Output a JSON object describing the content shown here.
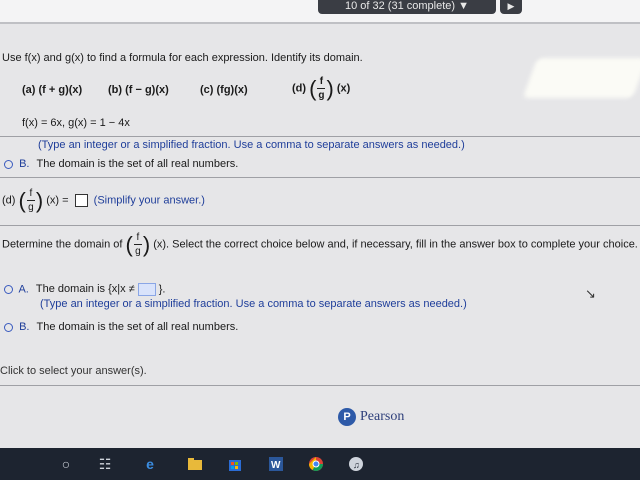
{
  "header": {
    "progress_text": "10 of 32 (31 complete)",
    "next_arrow": "▶",
    "dropdown_arrow": "▼"
  },
  "instructions": "Use f(x) and g(x) to find a formula for each expression. Identify its domain.",
  "parts": {
    "a": "(a) (f + g)(x)",
    "b": "(b) (f − g)(x)",
    "c": "(c) (fg)(x)",
    "d_label": "(d)",
    "d_suffix": "(x)"
  },
  "functions": "f(x) = 6x, g(x) = 1 − 4x",
  "prev_hint": "(Type an integer or a simplified fraction. Use a comma to separate answers as needed.)",
  "prev_choice_b": {
    "letter": "B.",
    "text": "The domain is the set of all real numbers."
  },
  "current": {
    "label": "(d)",
    "suffix": "(x) =",
    "hint": "(Simplify your answer.)"
  },
  "domain_prompt": {
    "prefix": "Determine the domain of",
    "suffix": "(x). Select the correct choice below and, if necessary, fill in the answer box to complete your choice."
  },
  "choices": [
    {
      "letter": "A.",
      "text": "The domain is {x|x ≠",
      "close": "}.",
      "hint": "(Type an integer or a simplified fraction. Use a comma to separate answers as needed.)"
    },
    {
      "letter": "B.",
      "text": "The domain is the set of all real numbers."
    }
  ],
  "footer_hint": "Click to select your answer(s).",
  "brand": "Pearson",
  "fraction": {
    "num": "f",
    "den": "g"
  },
  "taskbar_icons": [
    "cortana-circle",
    "task-view",
    "edge",
    "file-explorer",
    "store",
    "word",
    "chrome",
    "media"
  ],
  "colors": {
    "accent": "#1f3e9a",
    "taskbar": "#1d2430"
  }
}
